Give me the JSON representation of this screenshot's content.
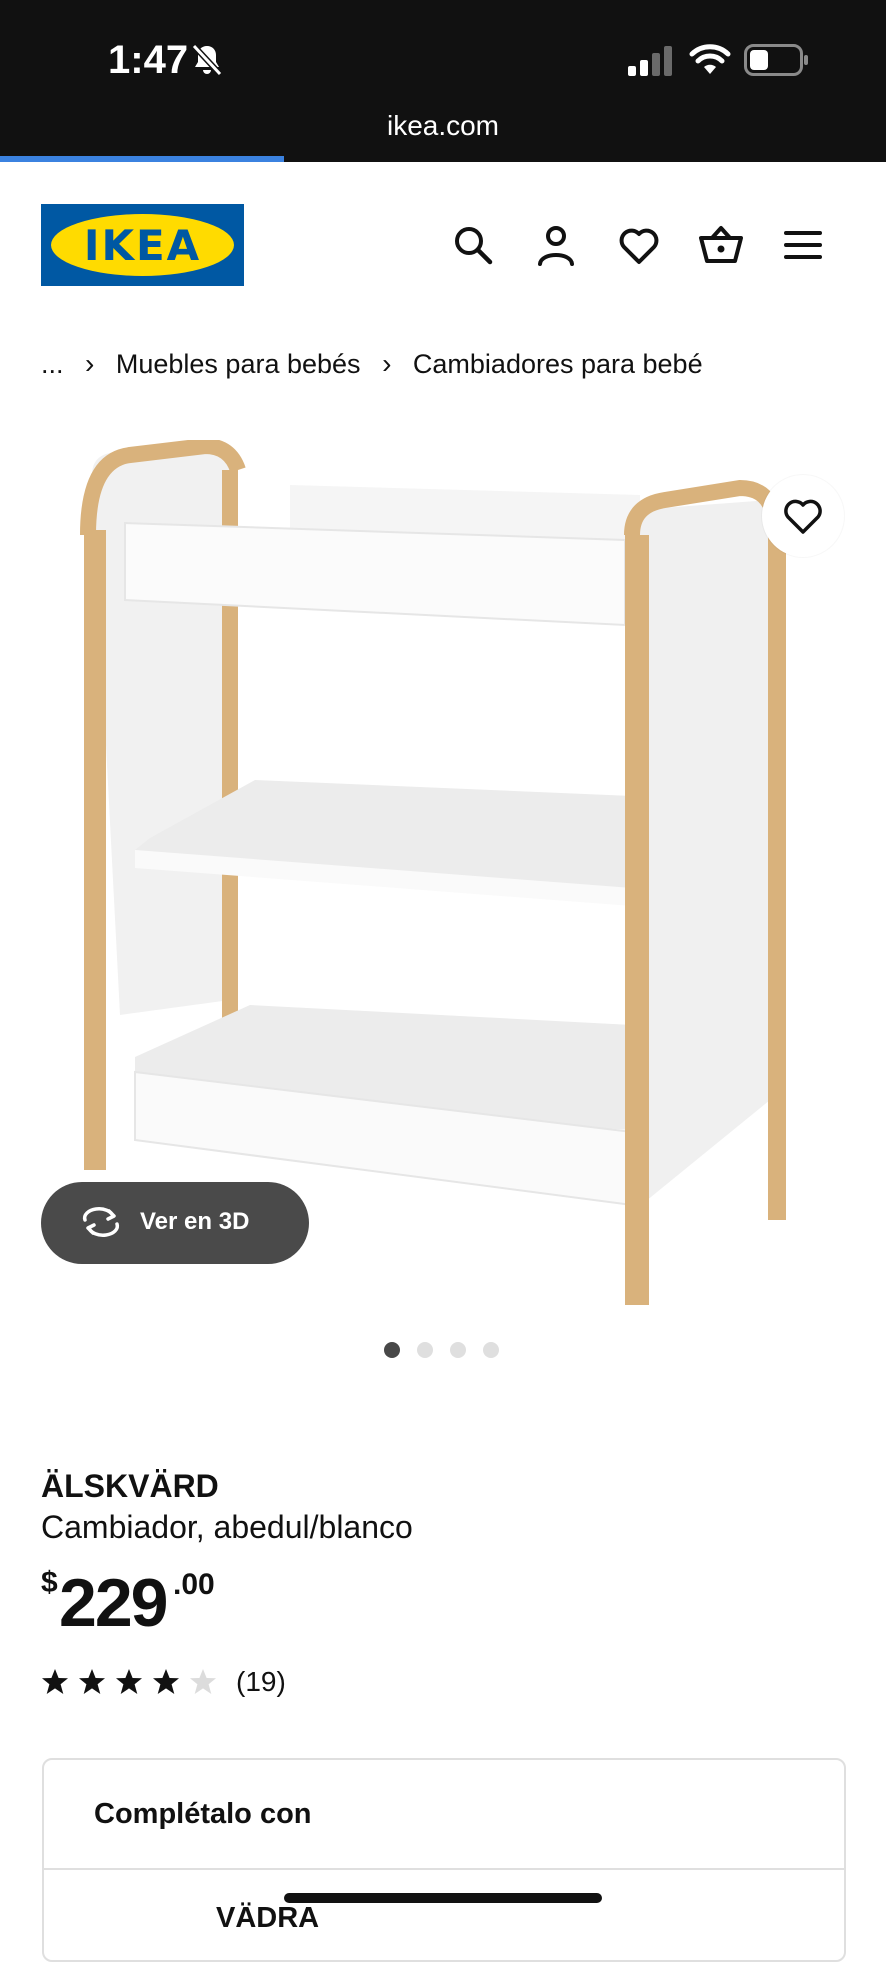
{
  "status_bar": {
    "time": "1:47",
    "url": "ikea.com",
    "load_progress": 0.32
  },
  "header": {
    "logo_text": "IKEA",
    "icons": [
      "search-icon",
      "account-icon",
      "heart-icon",
      "cart-icon",
      "menu-icon"
    ]
  },
  "breadcrumb": {
    "items": [
      "...",
      "Muebles para bebés",
      "Cambiadores para bebé"
    ],
    "separator": "›"
  },
  "gallery": {
    "view_3d_label": "Ver en 3D",
    "image_count": 4,
    "active_index": 0
  },
  "product": {
    "name": "ÄLSKVÄRD",
    "description": "Cambiador, abedul/blanco",
    "price_currency": "$",
    "price_integer": "229",
    "price_decimal": ".00",
    "rating": 4,
    "rating_max": 5,
    "reviews_count": "(19)"
  },
  "complete_with": {
    "title": "Complétalo con",
    "first_item": "VÄDRA"
  },
  "colors": {
    "ikea_blue": "#0058a3",
    "ikea_yellow": "#ffdb00",
    "progress_blue": "#3b82e0",
    "birch": "#d9b27c"
  }
}
